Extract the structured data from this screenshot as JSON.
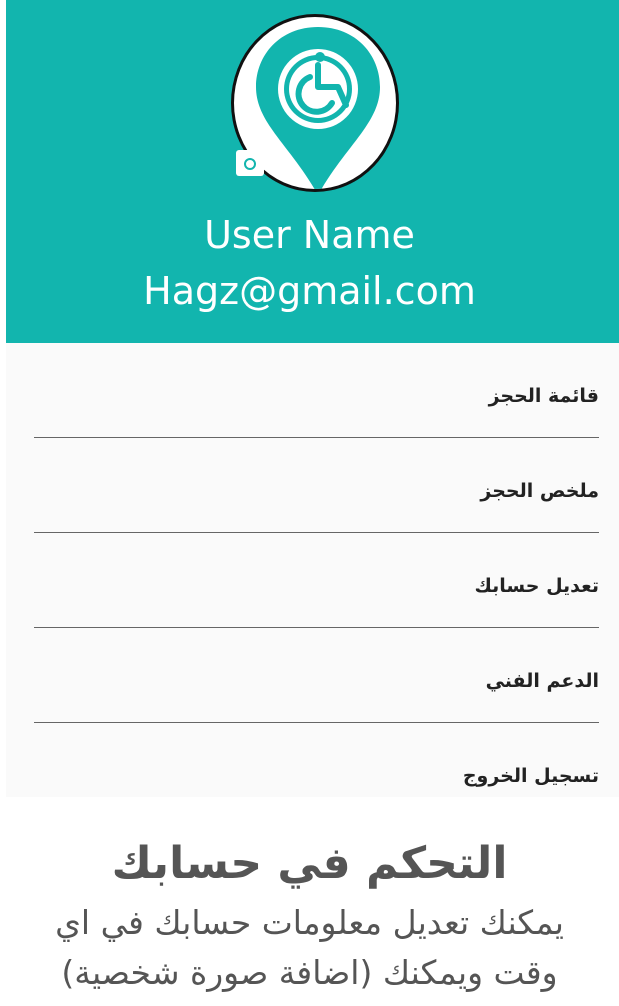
{
  "header": {
    "user_name": "User Name",
    "email": "Hagz@gmail.com",
    "accent_color": "#12b5ae",
    "avatar_icon": "wheelchair-location-pin-icon",
    "camera_icon": "camera-icon"
  },
  "menu": {
    "items": [
      {
        "label": "قائمة الحجز"
      },
      {
        "label": "ملخص الحجز"
      },
      {
        "label": "تعديل حسابك"
      },
      {
        "label": "الدعم الفني"
      },
      {
        "label": "تسجيل الخروج"
      }
    ]
  },
  "info": {
    "title": "التحكم في حسابك",
    "line1": "يمكنك تعديل معلومات حسابك في اي",
    "line2": "وقت ويمكنك (اضافة صورة شخصية)"
  }
}
